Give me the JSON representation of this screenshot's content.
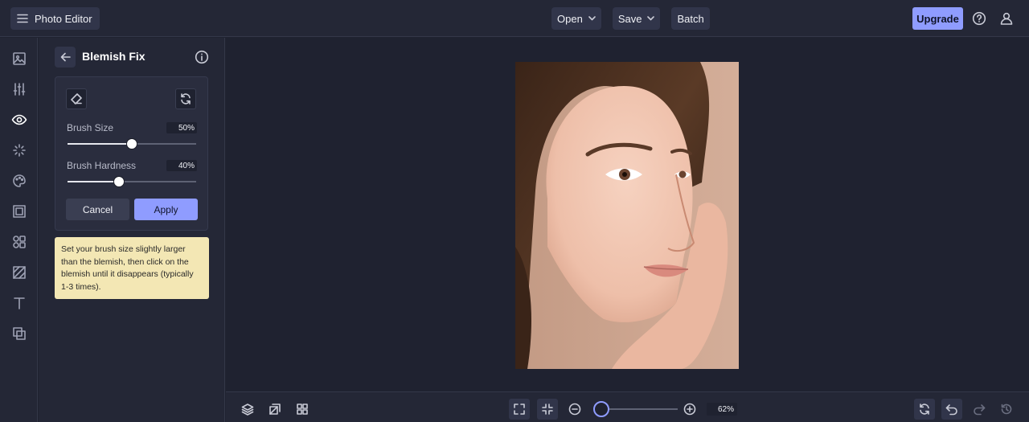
{
  "app": {
    "title": "Photo Editor"
  },
  "top_nav": {
    "open_label": "Open",
    "save_label": "Save",
    "batch_label": "Batch",
    "upgrade_label": "Upgrade"
  },
  "rail": {
    "items": [
      "image-icon",
      "sliders-icon",
      "eye-icon",
      "sparkle-icon",
      "palette-icon",
      "frame-icon",
      "shapes-icon",
      "texture-icon",
      "text-icon",
      "overlay-icon"
    ],
    "active": "eye-icon"
  },
  "panel": {
    "title": "Blemish Fix",
    "brush_size_label": "Brush Size",
    "brush_size_value": "50%",
    "brush_size": 50,
    "brush_hardness_label": "Brush Hardness",
    "brush_hardness_value": "40%",
    "brush_hardness": 40,
    "cancel_label": "Cancel",
    "apply_label": "Apply",
    "tip": "Set your brush size slightly larger than the blemish, then click on the blemish until it disappears (typically 1-3 times)."
  },
  "zoom": {
    "value_label": "62%",
    "value": 62
  },
  "colors": {
    "accent": "#8f9cff",
    "background": "#1f2230",
    "panel": "#242736",
    "tip": "#f3e7b4"
  }
}
